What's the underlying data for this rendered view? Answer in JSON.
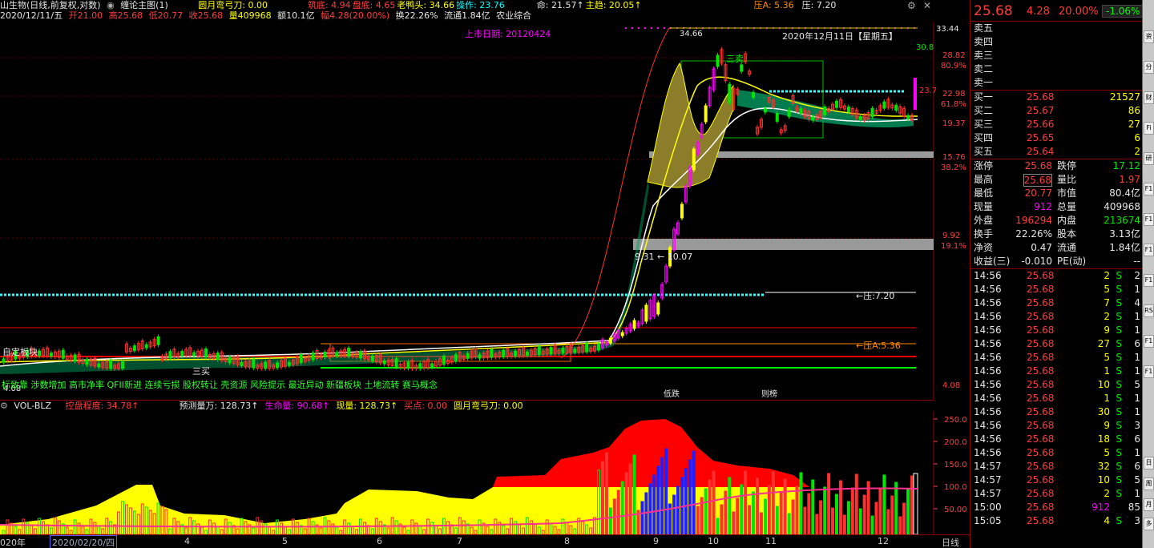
{
  "header": {
    "stock_name": "山生物(日线,前复权,对数)",
    "indicator": "缠论主图(1)",
    "items": [
      {
        "label": "圆月弯弓刀: 0.00",
        "color": "#ffff00"
      },
      {
        "label": "筑底: 4.94",
        "color": "#ff3c3c"
      },
      {
        "label": "盘底: 4.65",
        "color": "#ff3c3c"
      },
      {
        "label": "老鸭头: 34.66",
        "color": "#ffff00"
      },
      {
        "label": "操作: 23.76",
        "color": "#00ffff"
      },
      {
        "label": "命: 21.57↑",
        "color": "#e6e6e6"
      },
      {
        "label": "主趋: 20.05↑",
        "color": "#ffff00"
      },
      {
        "label": "压A: 5.36",
        "color": "#ff8c00"
      },
      {
        "label": "压: 7.20",
        "color": "#e6e6e6"
      }
    ]
  },
  "info": {
    "date": "2020/12/11/五",
    "open": "开21.00",
    "high": "高25.68",
    "low": "低20.77",
    "close": "收25.68",
    "volume": "量409968",
    "amount": "额10.1亿",
    "range": "幅4.28(20.00%)",
    "turnover": "换22.26%",
    "float": "流通1.84亿",
    "sector": "农业综合"
  },
  "chart": {
    "listing_date": "上市日期: 20120424",
    "date_label": "2020年12月11日【星期五】",
    "peak_label": "34.66",
    "sell_label": "三卖",
    "buy_label": "三买",
    "low_label": "4.08",
    "pressure_label": "←压:7.20",
    "pressureA_label": "←压A:5.36",
    "gap_label": "9.31 ← 10.07",
    "right_top_value": "33.44",
    "right_value_30": "30.8",
    "right_value_23": "23.7",
    "plate_label": "自定板块",
    "concepts": "标致靠 涉数增加 高市净率 QFII新进 连续亏损 股权转让 壳资源 风险提示 最近异动 新疆板块 土地流转 赛马概念",
    "marker1": "低跌",
    "marker2": "则榜",
    "y_labels": [
      {
        "value": "28.82",
        "pct": "80.9%"
      },
      {
        "value": "22.98",
        "pct": "61.8%"
      },
      {
        "value": "19.37",
        "pct": ""
      },
      {
        "value": "15.76",
        "pct": "38.2%"
      },
      {
        "value": "9.92",
        "pct": "19.1%"
      },
      {
        "value": "4.08",
        "pct": ""
      }
    ]
  },
  "volume": {
    "name": "VOL-BLZ",
    "items": [
      {
        "label": "控盘程度: 34.78↑",
        "color": "#ff3c3c"
      },
      {
        "label": "预测量万: 128.73↑",
        "color": "#e6e6e6"
      },
      {
        "label": "生命量: 90.68↑",
        "color": "#ff00ff"
      },
      {
        "label": "现量: 128.73↑",
        "color": "#ffff00"
      },
      {
        "label": "买点: 0.00",
        "color": "#ff3c3c"
      },
      {
        "label": "圆月弯弓刀: 0.00",
        "color": "#ffff00"
      }
    ],
    "y_labels": [
      "250.0",
      "200.0",
      "150.0",
      "100.0",
      "50.00"
    ]
  },
  "xaxis": {
    "labels": [
      "020年",
      "2020/02/20/四",
      "4",
      "5",
      "6",
      "7",
      "8",
      "9",
      "10",
      "11",
      "12"
    ],
    "right_label": "日线"
  },
  "quote": {
    "price": "25.68",
    "change": "4.28",
    "change_pct": "20.00%",
    "side_pct": "-1.06%",
    "sells": [
      {
        "label": "卖五",
        "price": "",
        "vol": ""
      },
      {
        "label": "卖四",
        "price": "",
        "vol": ""
      },
      {
        "label": "卖三",
        "price": "",
        "vol": ""
      },
      {
        "label": "卖二",
        "price": "",
        "vol": ""
      },
      {
        "label": "卖一",
        "price": "",
        "vol": ""
      }
    ],
    "buys": [
      {
        "label": "买一",
        "price": "25.68",
        "vol": "21527"
      },
      {
        "label": "买二",
        "price": "25.67",
        "vol": "86"
      },
      {
        "label": "买三",
        "price": "25.66",
        "vol": "27"
      },
      {
        "label": "买四",
        "price": "25.65",
        "vol": "6"
      },
      {
        "label": "买五",
        "price": "25.64",
        "vol": "2"
      }
    ],
    "stats": [
      {
        "k1": "涨停",
        "v1": "25.68",
        "c1": "#ff3c3c",
        "k2": "跌停",
        "v2": "17.12",
        "c2": "#00e600"
      },
      {
        "k1": "最高",
        "v1": "25.68",
        "c1": "#ff3c3c",
        "k2": "量比",
        "v2": "1.97",
        "c2": "#ff3c3c"
      },
      {
        "k1": "最低",
        "v1": "20.77",
        "c1": "#ff3c3c",
        "k2": "市值",
        "v2": "80.4亿",
        "c2": "#e6e6e6"
      },
      {
        "k1": "现量",
        "v1": "912",
        "c1": "#ff00ff",
        "k2": "总量",
        "v2": "409968",
        "c2": "#e6e6e6"
      },
      {
        "k1": "外盘",
        "v1": "196294",
        "c1": "#ff3c3c",
        "k2": "内盘",
        "v2": "213674",
        "c2": "#00e600"
      },
      {
        "k1": "换手",
        "v1": "22.26%",
        "c1": "#e6e6e6",
        "k2": "股本",
        "v2": "3.13亿",
        "c2": "#e6e6e6"
      },
      {
        "k1": "净资",
        "v1": "0.47",
        "c1": "#e6e6e6",
        "k2": "流通",
        "v2": "1.84亿",
        "c2": "#e6e6e6"
      },
      {
        "k1": "收益(三)",
        "v1": "-0.010",
        "c1": "#e6e6e6",
        "k2": "PE(动)",
        "v2": "--",
        "c2": "#e6e6e6"
      }
    ],
    "ticks": [
      {
        "t": "14:56",
        "p": "25.68",
        "v": "2",
        "s": "S",
        "n": "2"
      },
      {
        "t": "14:56",
        "p": "25.68",
        "v": "5",
        "s": "S",
        "n": "1"
      },
      {
        "t": "14:56",
        "p": "25.68",
        "v": "7",
        "s": "S",
        "n": "4"
      },
      {
        "t": "14:56",
        "p": "25.68",
        "v": "2",
        "s": "S",
        "n": "1"
      },
      {
        "t": "14:56",
        "p": "25.68",
        "v": "9",
        "s": "S",
        "n": "1"
      },
      {
        "t": "14:56",
        "p": "25.68",
        "v": "27",
        "s": "S",
        "n": "6"
      },
      {
        "t": "14:56",
        "p": "25.68",
        "v": "5",
        "s": "S",
        "n": "1"
      },
      {
        "t": "14:56",
        "p": "25.68",
        "v": "1",
        "s": "S",
        "n": "1"
      },
      {
        "t": "14:56",
        "p": "25.68",
        "v": "10",
        "s": "S",
        "n": "5"
      },
      {
        "t": "14:56",
        "p": "25.68",
        "v": "1",
        "s": "S",
        "n": "1"
      },
      {
        "t": "14:56",
        "p": "25.68",
        "v": "30",
        "s": "S",
        "n": "1"
      },
      {
        "t": "14:56",
        "p": "25.68",
        "v": "9",
        "s": "S",
        "n": "3"
      },
      {
        "t": "14:56",
        "p": "25.68",
        "v": "18",
        "s": "S",
        "n": "6"
      },
      {
        "t": "14:56",
        "p": "25.68",
        "v": "5",
        "s": "S",
        "n": "1"
      },
      {
        "t": "14:57",
        "p": "25.68",
        "v": "32",
        "s": "S",
        "n": "6"
      },
      {
        "t": "14:57",
        "p": "25.68",
        "v": "10",
        "s": "S",
        "n": "5"
      },
      {
        "t": "14:57",
        "p": "25.68",
        "v": "2",
        "s": "S",
        "n": "1"
      },
      {
        "t": "15:00",
        "p": "25.68",
        "v": "912",
        "s": "",
        "n": "85"
      },
      {
        "t": "15:05",
        "p": "25.68",
        "v": "4",
        "s": "S",
        "n": "3"
      }
    ]
  },
  "strip": [
    "资",
    "分",
    "财",
    "Fi",
    "研",
    "F1",
    "F1",
    "F1",
    "F1",
    "RS",
    "F1",
    "F1",
    "日",
    "周",
    "月",
    "多"
  ]
}
